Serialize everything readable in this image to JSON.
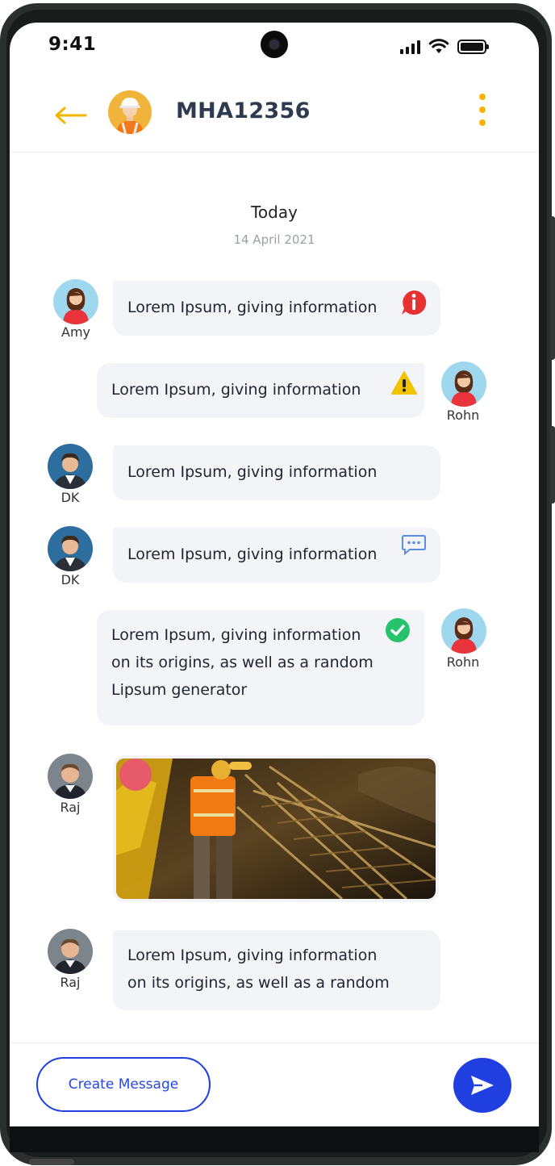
{
  "status_bar": {
    "time": "9:41"
  },
  "header": {
    "title": "MHA12356"
  },
  "date_section": {
    "label": "Today",
    "date": "14 April 2021"
  },
  "messages": [
    {
      "sender": "Amy",
      "lines": [
        "Lorem Ipsum, giving information"
      ],
      "icon": "info-icon"
    },
    {
      "sender": "Rohn",
      "lines": [
        "Lorem Ipsum, giving information"
      ],
      "icon": "warning-icon"
    },
    {
      "sender": "DK",
      "lines": [
        "Lorem Ipsum, giving information"
      ]
    },
    {
      "sender": "DK",
      "lines": [
        "Lorem Ipsum, giving information"
      ],
      "icon": "chat-bubble-icon"
    },
    {
      "sender": "Rohn",
      "lines": [
        "Lorem Ipsum, giving information",
        "on its origins, as well as a random",
        "Lipsum generator"
      ],
      "icon": "check-circle-icon"
    },
    {
      "sender": "Raj",
      "type": "image",
      "image": "construction-site-photo"
    },
    {
      "sender": "Raj",
      "lines": [
        "Lorem Ipsum, giving information",
        "on its origins, as well as a random"
      ]
    }
  ],
  "footer": {
    "create_label": "Create Message",
    "send_icon": "send-icon"
  },
  "colors": {
    "accent_yellow": "#f2b600",
    "primary_blue": "#1f3fe0",
    "bubble_bg": "#f2f4f7",
    "title": "#2e3a4f"
  }
}
